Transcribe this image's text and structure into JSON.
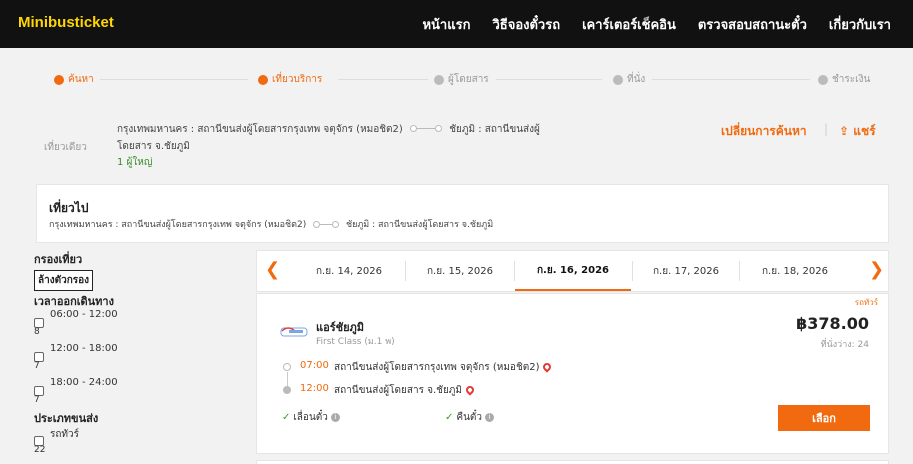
{
  "header": {
    "logo": "Minibusticket",
    "nav": [
      "หน้าแรก",
      "วิธีจองตั๋วรถ",
      "เคาร์เตอร์เช็คอิน",
      "ตรวจสอบสถานะตั๋ว",
      "เกี่ยวกับเรา"
    ]
  },
  "steps": [
    "ค้นหา",
    "เที่ยวบริการ",
    "ผู้โดยสาร",
    "ที่นั่ง",
    "ชำระเงิน"
  ],
  "summary": {
    "trip_type": "เที่ยวเดียว",
    "route_from": "กรุงเทพมหานคร : สถานีขนส่งผู้โดยสารกรุงเทพ จตุจักร (หมอชิต2)",
    "route_to_a": "ชัยภูมิ : สถานีขนส่งผู้",
    "route_to_b": "โดยสาร จ.ชัยภูมิ",
    "passengers": "1 ผู้ใหญ่",
    "change_search": "เปลี่ยนการค้นหา",
    "share": "แชร์"
  },
  "trip": {
    "title": "เที่ยวไป",
    "from": "กรุงเทพมหานคร : สถานีขนส่งผู้โดยสารกรุงเทพ จตุจักร (หมอชิต2)",
    "to": "ชัยภูมิ : สถานีขนส่งผู้โดยสาร จ.ชัยภูมิ"
  },
  "filters": {
    "title": "กรองเที่ยว",
    "clear": "ล้างตัวกรอง",
    "departure_title": "เวลาออกเดินทาง",
    "times": [
      {
        "label": "06:00 - 12:00",
        "count": "8"
      },
      {
        "label": "12:00 - 18:00",
        "count": "7"
      },
      {
        "label": "18:00 - 24:00",
        "count": "7"
      }
    ],
    "vehicle_title": "ประเภทขนส่ง",
    "vehicles": [
      {
        "label": "รถทัวร์",
        "count": "22"
      }
    ]
  },
  "dates": [
    "ก.ย. 14, 2026",
    "ก.ย. 15, 2026",
    "ก.ย. 16, 2026",
    "ก.ย. 17, 2026",
    "ก.ย. 18, 2026"
  ],
  "result": {
    "vehicle_type": "รถทัวร์",
    "operator": "แอร์ชัยภูมิ",
    "class": "First Class (ม.1 พ)",
    "price": "฿378.00",
    "seats": "ที่นั่งว่าง: 24",
    "depart_time": "07:00",
    "depart_station": "สถานีขนส่งผู้โดยสารกรุงเทพ จตุจักร (หมอชิต2)",
    "arrive_time": "12:00",
    "arrive_station": "สถานีขนส่งผู้โดยสาร จ.ชัยภูมิ",
    "policy_change": "เลื่อนตั๋ว",
    "policy_refund": "คืนตั๋ว",
    "select": "เลือก"
  },
  "colors": {
    "accent": "#f26a0f",
    "header_bg": "#111111",
    "logo": "#ffd600"
  }
}
